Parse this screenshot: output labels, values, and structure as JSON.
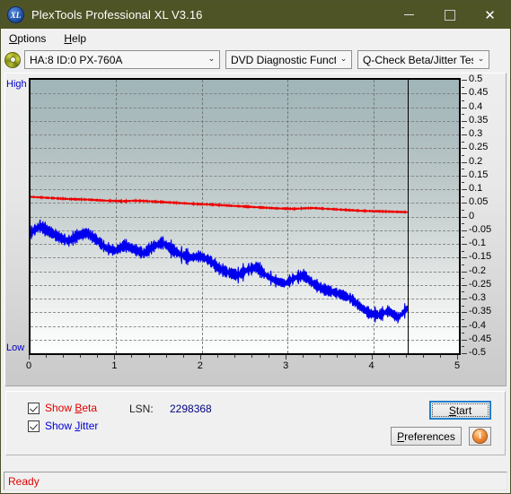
{
  "window": {
    "title": "PlexTools Professional XL V3.16",
    "logo_text": "XL",
    "minimize": "–",
    "maximize": "□",
    "close": "✕"
  },
  "menubar": {
    "items": [
      {
        "label": "Options",
        "accel": "O"
      },
      {
        "label": "Help",
        "accel": "H"
      }
    ]
  },
  "toolbar": {
    "drive_select": "HA:8 ID:0  PX-760A",
    "function_select": "DVD Diagnostic Functions",
    "test_select": "Q-Check Beta/Jitter Test",
    "chevron": "⌄"
  },
  "controls": {
    "show_beta": "Show Beta",
    "show_jitter": "Show Jitter",
    "show_beta_checked": true,
    "show_jitter_checked": true,
    "lsn_label": "LSN:",
    "lsn_value": "2298368",
    "start": "Start",
    "preferences": "Preferences",
    "info": "i"
  },
  "statusbar": {
    "text": "Ready"
  },
  "chart_data": {
    "type": "line",
    "title": "Q-Check Beta/Jitter Test",
    "xlabel": "",
    "ylabel": "",
    "xlim": [
      0,
      5
    ],
    "ylim": [
      -0.5,
      0.5
    ],
    "xticks": [
      0,
      1,
      2,
      3,
      4,
      5
    ],
    "yticks": [
      0.5,
      0.45,
      0.4,
      0.35,
      0.3,
      0.25,
      0.2,
      0.15,
      0.1,
      0.05,
      0,
      -0.05,
      -0.1,
      -0.15,
      -0.2,
      -0.25,
      -0.3,
      -0.35,
      -0.4,
      -0.45,
      -0.5
    ],
    "y_axis_end_labels": {
      "top": "High",
      "bottom": "Low"
    },
    "grid": true,
    "grid_style": "dashed",
    "cursor_x": 4.4,
    "data_end_x": 4.4,
    "legend_position": "below-plot",
    "series": [
      {
        "name": "Beta",
        "color": "#ee0000",
        "x": [
          0.0,
          0.11,
          0.22,
          0.33,
          0.44,
          0.55,
          0.66,
          0.77,
          0.88,
          0.99,
          1.1,
          1.21,
          1.32,
          1.43,
          1.54,
          1.65,
          1.76,
          1.87,
          1.98,
          2.09,
          2.2,
          2.31,
          2.42,
          2.53,
          2.64,
          2.75,
          2.86,
          2.97,
          3.08,
          3.19,
          3.3,
          3.41,
          3.52,
          3.63,
          3.74,
          3.85,
          3.96,
          4.07,
          4.18,
          4.29,
          4.4
        ],
        "values": [
          0.072,
          0.07,
          0.068,
          0.066,
          0.064,
          0.063,
          0.062,
          0.06,
          0.058,
          0.057,
          0.056,
          0.058,
          0.057,
          0.055,
          0.053,
          0.051,
          0.049,
          0.047,
          0.045,
          0.044,
          0.042,
          0.04,
          0.038,
          0.036,
          0.034,
          0.032,
          0.03,
          0.029,
          0.028,
          0.03,
          0.031,
          0.029,
          0.027,
          0.025,
          0.023,
          0.021,
          0.02,
          0.019,
          0.018,
          0.017,
          0.016
        ]
      },
      {
        "name": "Jitter",
        "color": "#0000ee",
        "x": [
          0.0,
          0.11,
          0.22,
          0.33,
          0.44,
          0.55,
          0.66,
          0.77,
          0.88,
          0.99,
          1.1,
          1.21,
          1.32,
          1.43,
          1.54,
          1.65,
          1.76,
          1.87,
          1.98,
          2.09,
          2.2,
          2.31,
          2.42,
          2.53,
          2.64,
          2.75,
          2.86,
          2.97,
          3.08,
          3.19,
          3.3,
          3.41,
          3.52,
          3.63,
          3.74,
          3.85,
          3.96,
          4.07,
          4.18,
          4.29,
          4.4
        ],
        "values": [
          -0.06,
          -0.035,
          -0.055,
          -0.075,
          -0.09,
          -0.07,
          -0.06,
          -0.085,
          -0.115,
          -0.125,
          -0.105,
          -0.12,
          -0.135,
          -0.11,
          -0.095,
          -0.12,
          -0.14,
          -0.15,
          -0.145,
          -0.16,
          -0.19,
          -0.205,
          -0.215,
          -0.195,
          -0.185,
          -0.215,
          -0.235,
          -0.245,
          -0.225,
          -0.215,
          -0.245,
          -0.265,
          -0.275,
          -0.285,
          -0.3,
          -0.33,
          -0.355,
          -0.36,
          -0.345,
          -0.37,
          -0.335
        ],
        "band": 0.035
      }
    ]
  }
}
